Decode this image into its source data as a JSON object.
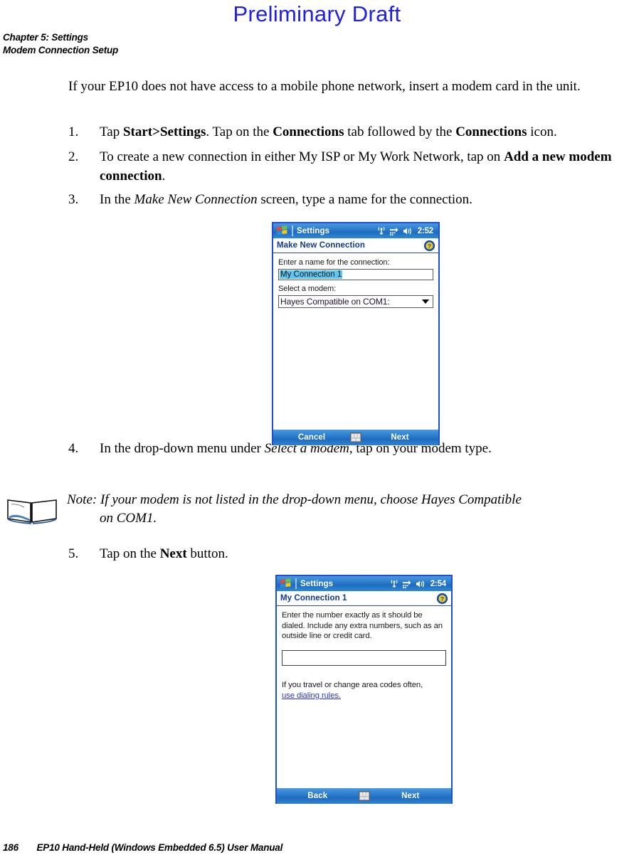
{
  "watermark": "Preliminary Draft",
  "header": {
    "chapter": "Chapter 5:  Settings",
    "section": "Modem Connection Setup"
  },
  "intro": "If your EP10 does not have access to a mobile phone network, insert a modem card in the unit.",
  "steps": [
    {
      "num": "1.",
      "parts": [
        {
          "t": "Tap ",
          "s": "n"
        },
        {
          "t": "Start>Settings",
          "s": "b"
        },
        {
          "t": ". Tap on the ",
          "s": "n"
        },
        {
          "t": "Connections",
          "s": "b"
        },
        {
          "t": " tab followed by the ",
          "s": "n"
        },
        {
          "t": "Connections",
          "s": "b"
        },
        {
          "t": " icon.",
          "s": "n"
        }
      ]
    },
    {
      "num": "2.",
      "parts": [
        {
          "t": "To create a new connection in either My ISP or My Work Network, tap on ",
          "s": "n"
        },
        {
          "t": "Add a new modem connection",
          "s": "b"
        },
        {
          "t": ".",
          "s": "n"
        }
      ]
    },
    {
      "num": "3.",
      "parts": [
        {
          "t": "In the ",
          "s": "n"
        },
        {
          "t": "Make New Connection",
          "s": "i"
        },
        {
          "t": " screen, type a name for the connection.",
          "s": "n"
        }
      ]
    },
    {
      "num": "4.",
      "parts": [
        {
          "t": "In the drop-down menu under ",
          "s": "n"
        },
        {
          "t": "Select a modem",
          "s": "i"
        },
        {
          "t": ", tap on your modem type.",
          "s": "n"
        }
      ]
    },
    {
      "num": "5.",
      "parts": [
        {
          "t": "Tap on the ",
          "s": "n"
        },
        {
          "t": "Next",
          "s": "b"
        },
        {
          "t": " button.",
          "s": "n"
        }
      ]
    }
  ],
  "note": {
    "icon": "open-book-icon",
    "line1": "Note: If your modem is not listed in the drop-down menu, choose Hayes Compatible",
    "line2": "on COM1."
  },
  "screen1": {
    "titlebar": {
      "start_icon": "windows-flag-icon",
      "title": "Settings",
      "icons": [
        "antenna-signal-icon",
        "connectivity-icon",
        "speaker-icon"
      ],
      "clock": "2:52"
    },
    "subtitle": "Make New Connection",
    "help_icon": "help-question-icon",
    "name_label": "Enter a name for the connection:",
    "name_value": "My Connection 1",
    "modem_label": "Select a modem:",
    "modem_value": "Hayes Compatible on COM1:",
    "modem_options": [
      "Hayes Compatible on COM1:"
    ],
    "cmdbar": {
      "left": "Cancel",
      "keyboard_icon": "soft-keyboard-icon",
      "right": "Next"
    }
  },
  "screen2": {
    "titlebar": {
      "start_icon": "windows-flag-icon",
      "title": "Settings",
      "icons": [
        "antenna-signal-icon",
        "connectivity-icon",
        "speaker-icon"
      ],
      "clock": "2:54"
    },
    "subtitle": "My Connection 1",
    "help_icon": "help-question-icon",
    "instruction": "Enter the number exactly as it should be dialed.  Include any extra numbers, such as an outside line or credit card.",
    "number_value": "",
    "travel_text": "If you travel or change area codes often,",
    "link_text": "use dialing rules.",
    "cmdbar": {
      "left": "Back",
      "keyboard_icon": "soft-keyboard-icon",
      "right": "Next"
    }
  },
  "footer": {
    "page": "186",
    "title": "EP10 Hand-Held (Windows Embedded 6.5) User Manual"
  },
  "colors": {
    "watermark_blue": "#2020e0",
    "titlebar_blue": "#2878c8",
    "device_border": "#1f4fd8",
    "subtitle_text": "#113a8c",
    "selection_highlight": "#5ec8f0",
    "link_blue": "#2a36c8"
  }
}
